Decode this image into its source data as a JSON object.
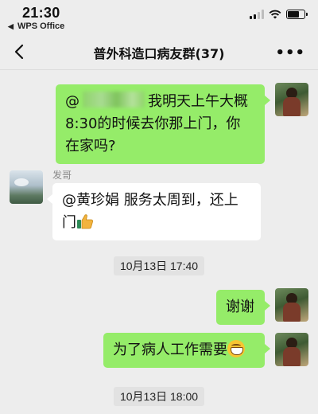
{
  "status_bar": {
    "time": "21:30",
    "back_app": "WPS Office"
  },
  "header": {
    "title": "普外科造口病友群(37)",
    "more_label": "•••"
  },
  "messages": [
    {
      "type": "outgoing",
      "prefix": "@",
      "mention_blurred": true,
      "text": "我明天上午大概8:30的时候去你那上门，你在家吗?"
    },
    {
      "type": "incoming",
      "sender": "发哥",
      "text": "@黄珍娟 服务太周到，还上门",
      "emoji": "thumbs-up"
    },
    {
      "type": "timestamp",
      "text": "10月13日 17:40"
    },
    {
      "type": "outgoing",
      "text": "谢谢"
    },
    {
      "type": "outgoing",
      "text": "为了病人工作需要",
      "emoji": "grin"
    },
    {
      "type": "timestamp",
      "text": "10月13日 18:00"
    }
  ],
  "display": {
    "m1_line1": "我明天上午大概",
    "m1_line2": "8:30的时候去你那上门，你",
    "m1_line3": "在家吗?",
    "m2_line1": "@黄珍娟 服务太周到，还上",
    "m2_line2": "门",
    "m3": "谢谢",
    "m4": "为了病人工作需要",
    "prefix": "@"
  },
  "colors": {
    "background": "#ededed",
    "outgoing_bubble": "#95ec69",
    "incoming_bubble": "#ffffff"
  }
}
